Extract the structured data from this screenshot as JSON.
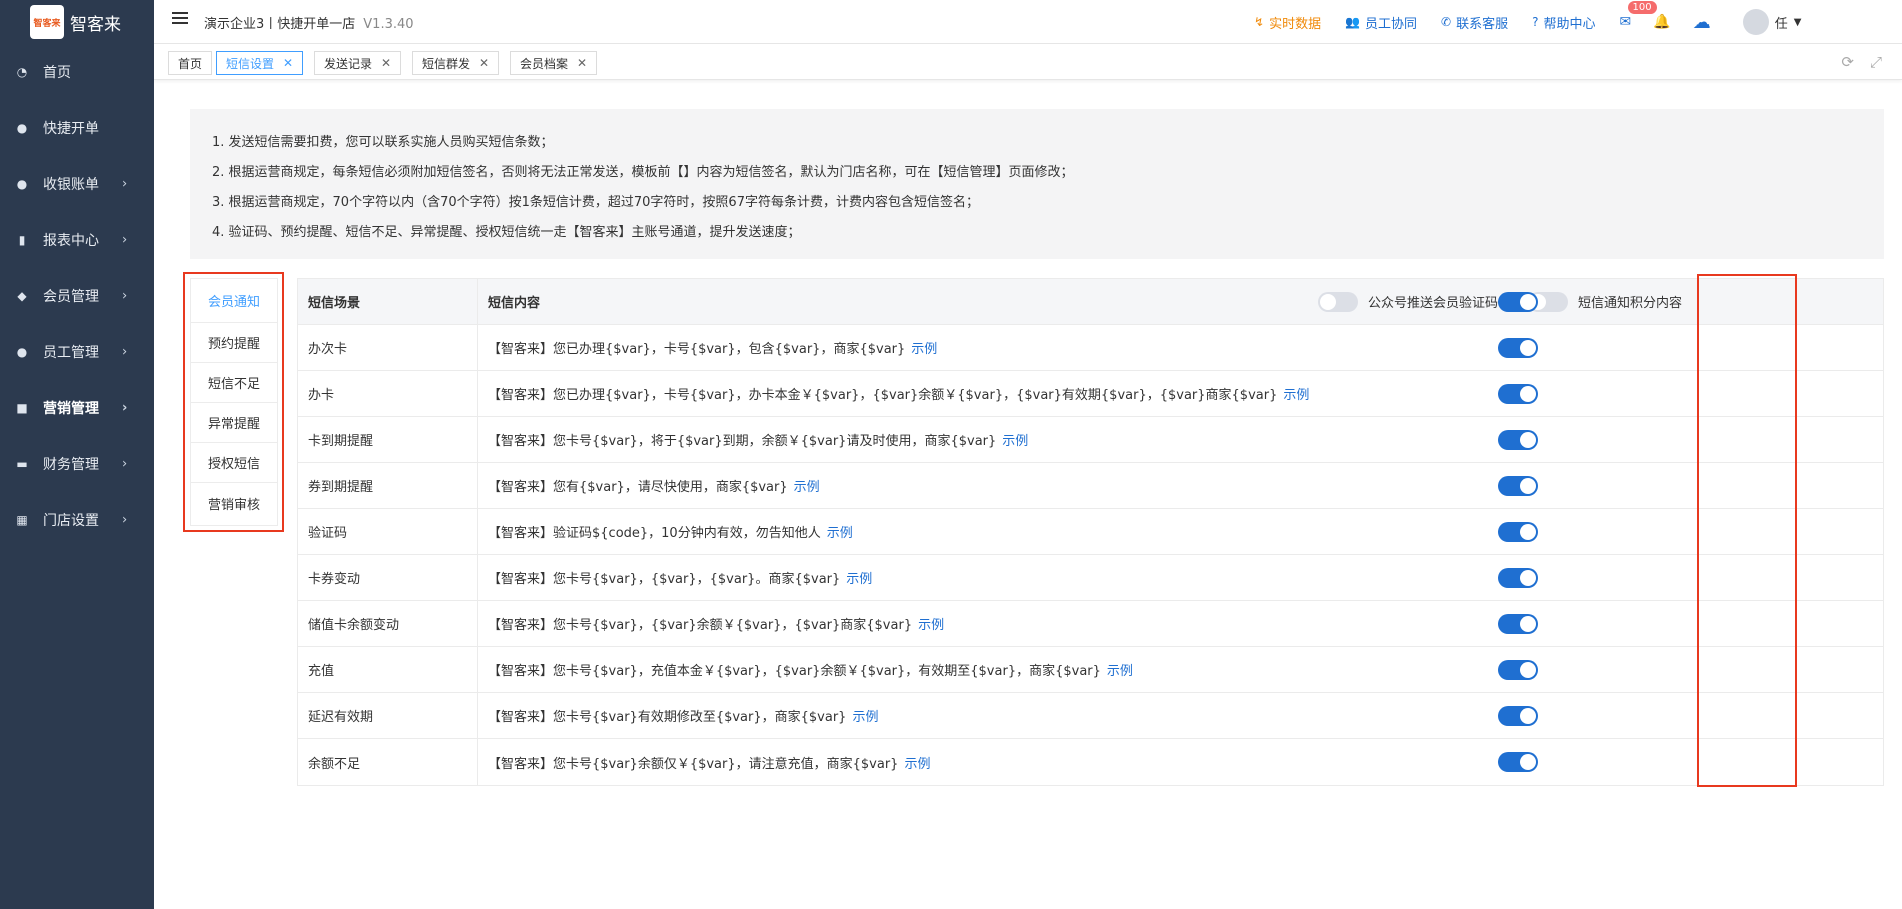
{
  "app": {
    "logo_mark": "智客来",
    "logo_text": "智客来",
    "company": "演示企业3丨快捷开单一店",
    "version": "V1.3.40"
  },
  "sidebar": {
    "items": [
      {
        "label": "首页",
        "icon": "dashboard-icon",
        "glyph": "◔",
        "chevron": ""
      },
      {
        "label": "快捷开单",
        "icon": "money-bag-icon",
        "glyph": "●",
        "chevron": ""
      },
      {
        "label": "收银账单",
        "icon": "money-bag-icon",
        "glyph": "●",
        "chevron": "›"
      },
      {
        "label": "报表中心",
        "icon": "bar-chart-icon",
        "glyph": "▮",
        "chevron": "›"
      },
      {
        "label": "会员管理",
        "icon": "diamond-icon",
        "glyph": "◆",
        "chevron": "›"
      },
      {
        "label": "员工管理",
        "icon": "user-icon",
        "glyph": "●",
        "chevron": "›"
      },
      {
        "label": "营销管理",
        "icon": "briefcase-icon",
        "glyph": "■",
        "chevron": "›"
      },
      {
        "label": "财务管理",
        "icon": "wallet-icon",
        "glyph": "▬",
        "chevron": "›"
      },
      {
        "label": "门店设置",
        "icon": "grid-icon",
        "glyph": "▦",
        "chevron": "›"
      }
    ],
    "active_index": 6
  },
  "header": {
    "links": [
      {
        "label": "实时数据",
        "icon": "trend-icon",
        "glyph": "↯"
      },
      {
        "label": "员工协同",
        "icon": "users-icon",
        "glyph": "👥"
      },
      {
        "label": "联系客服",
        "icon": "phone-icon",
        "glyph": "✆"
      },
      {
        "label": "帮助中心",
        "icon": "help-icon",
        "glyph": "?"
      }
    ],
    "mail_badge": "100",
    "user_name": "任"
  },
  "tabs": [
    {
      "label": "首页",
      "closable": false
    },
    {
      "label": "短信设置",
      "closable": true
    },
    {
      "label": "发送记录",
      "closable": true
    },
    {
      "label": "短信群发",
      "closable": true
    },
    {
      "label": "会员档案",
      "closable": true
    }
  ],
  "active_tab": 1,
  "notice": [
    "1. 发送短信需要扣费，您可以联系实施人员购买短信条数；",
    "2. 根据运营商规定，每条短信必须附加短信签名，否则将无法正常发送，模板前【】内容为短信签名，默认为门店名称，可在【短信管理】页面修改；",
    "3. 根据运营商规定，70个字符以内（含70个字符）按1条短信计费，超过70字符时，按照67字符每条计费，计费内容包含短信签名；",
    "4. 验证码、预约提醒、短信不足、异常提醒、授权短信统一走【智客来】主账号通道，提升发送速度；"
  ],
  "subtabs": [
    "会员通知",
    "预约提醒",
    "短信不足",
    "异常提醒",
    "授权短信",
    "营销审核"
  ],
  "active_subtab": 0,
  "table": {
    "col_scene": "短信场景",
    "col_content": "短信内容",
    "header_toggles": [
      {
        "label": "公众号推送会员验证码",
        "on": false
      },
      {
        "label": "短信通知积分内容",
        "on": false
      }
    ],
    "header_master_on": true,
    "example_label": "示例",
    "rows": [
      {
        "scene": "办次卡",
        "content": "【智客来】您已办理{$var}，卡号{$var}，包含{$var}，商家{$var}",
        "on": true
      },
      {
        "scene": "办卡",
        "content": "【智客来】您已办理{$var}，卡号{$var}，办卡本金￥{$var}，{$var}余额￥{$var}，{$var}有效期{$var}，{$var}商家{$var}",
        "on": true
      },
      {
        "scene": "卡到期提醒",
        "content": "【智客来】您卡号{$var}，将于{$var}到期，余额￥{$var}请及时使用，商家{$var}",
        "on": true
      },
      {
        "scene": "券到期提醒",
        "content": "【智客来】您有{$var}，请尽快使用，商家{$var}",
        "on": true
      },
      {
        "scene": "验证码",
        "content": "【智客来】验证码${code}，10分钟内有效，勿告知他人",
        "on": true
      },
      {
        "scene": "卡券变动",
        "content": "【智客来】您卡号{$var}，{$var}，{$var}。商家{$var}",
        "on": true
      },
      {
        "scene": "储值卡余额变动",
        "content": "【智客来】您卡号{$var}，{$var}余额￥{$var}，{$var}商家{$var}",
        "on": true
      },
      {
        "scene": "充值",
        "content": "【智客来】您卡号{$var}，充值本金￥{$var}，{$var}余额￥{$var}，有效期至{$var}，商家{$var}",
        "on": true
      },
      {
        "scene": "延迟有效期",
        "content": "【智客来】您卡号{$var}有效期修改至{$var}，商家{$var}",
        "on": true
      },
      {
        "scene": "余额不足",
        "content": "【智客来】您卡号{$var}余额仅￥{$var}，请注意充值，商家{$var}",
        "on": true
      }
    ]
  },
  "colors": {
    "sidebar_bg": "#2c3a4f",
    "accent": "#1f6fd1",
    "highlight_red": "#e8391f",
    "orange": "#f08a0a"
  }
}
